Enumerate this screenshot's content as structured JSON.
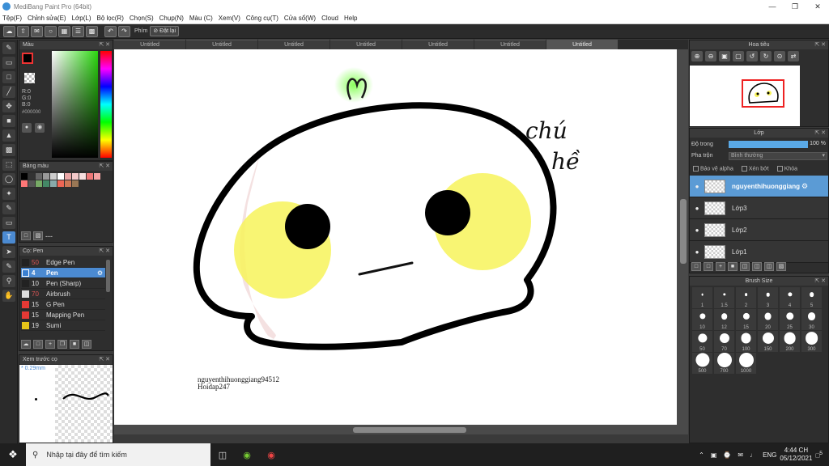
{
  "window": {
    "title": "MediBang Paint Pro (64bit)"
  },
  "menu": [
    "Tệp(F)",
    "Chỉnh sửa(E)",
    "Lớp(L)",
    "Bộ lọc(R)",
    "Chọn(S)",
    "Chụp(N)",
    "Màu (C)",
    "Xem(V)",
    "Công cụ(T)",
    "Cửa sổ(W)",
    "Cloud",
    "Help"
  ],
  "toolbar": {
    "shortcut_label": "Phím",
    "reset_label": "Đặt lại"
  },
  "color_panel": {
    "title": "Màu",
    "r": "R:0",
    "g": "G:0",
    "b": "B:0",
    "hex": "#000000"
  },
  "palette_panel": {
    "title": "Bảng màu",
    "footer_text": "---"
  },
  "brush_panel": {
    "title": "Cọ: Pen",
    "items": [
      {
        "size": "50",
        "name": "Edge Pen",
        "color": "#222222"
      },
      {
        "size": "4",
        "name": "Pen",
        "color": "#3a7fd0"
      },
      {
        "size": "10",
        "name": "Pen (Sharp)",
        "color": "#222222"
      },
      {
        "size": "70",
        "name": "Airbrush",
        "color": "#dddddd"
      },
      {
        "size": "15",
        "name": "G Pen",
        "color": "#e53935"
      },
      {
        "size": "15",
        "name": "Mapping Pen",
        "color": "#e53935"
      },
      {
        "size": "19",
        "name": "Sumi",
        "color": "#e6c619"
      }
    ]
  },
  "preview_panel": {
    "title": "Xem trước cọ",
    "size": "* 0.29mm"
  },
  "doc_tabs": [
    "Untitled",
    "Untitled",
    "Untitled",
    "Untitled",
    "Untitled",
    "Untitled",
    "Untitled"
  ],
  "canvas": {
    "text_line1": "chú",
    "text_line2": "hề",
    "watermark_line1": "nguyenthihuonggiang94512",
    "watermark_line2": "Hoidap247"
  },
  "navigator": {
    "title": "Hoa tiêu"
  },
  "layer_panel": {
    "title": "Lớp",
    "opacity_label": "Độ trong",
    "opacity_value": "100 %",
    "opacity_fraction": 1.0,
    "blend_label": "Pha trộn",
    "blend_value": "Bình thường",
    "protect_alpha": "Bảo vệ alpha",
    "clipping": "Xén bớt",
    "lock": "Khóa",
    "layers": [
      "nguyenthihuonggiang",
      "Lớp3",
      "Lớp2",
      "Lớp1"
    ]
  },
  "brush_size_panel": {
    "title": "Brush Size",
    "sizes": [
      "1",
      "1.5",
      "2",
      "3",
      "4",
      "5",
      "10",
      "12",
      "15",
      "20",
      "25",
      "30",
      "50",
      "70",
      "100",
      "150",
      "200",
      "300",
      "500",
      "700",
      "1000"
    ]
  },
  "taskbar": {
    "search_placeholder": "Nhập tại đây để tìm kiếm",
    "language": "ENG",
    "time": "4:44 CH",
    "date": "05/12/2021",
    "notifications": "5"
  },
  "colors": {
    "accent": "#4b8ad1",
    "layer_active": "#5b9bd5",
    "panel_bg": "#2e2e2e"
  }
}
